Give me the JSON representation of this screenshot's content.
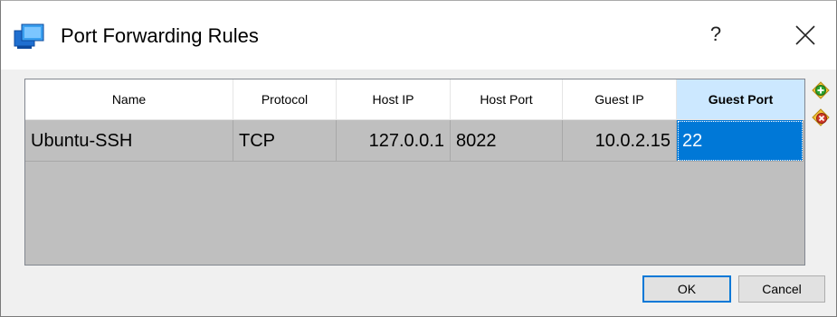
{
  "window": {
    "title": "Port Forwarding Rules",
    "help_label": "?"
  },
  "table": {
    "columns": [
      "Name",
      "Protocol",
      "Host IP",
      "Host Port",
      "Guest IP",
      "Guest Port"
    ],
    "active_column": "Guest Port",
    "rows": [
      {
        "name": "Ubuntu-SSH",
        "protocol": "TCP",
        "host_ip": "127.0.0.1",
        "host_port": "8022",
        "guest_ip": "10.0.2.15",
        "guest_port": "22"
      }
    ]
  },
  "side_actions": {
    "add_icon": "add-rule-icon",
    "remove_icon": "remove-rule-icon"
  },
  "buttons": {
    "ok": "OK",
    "cancel": "Cancel"
  },
  "colors": {
    "selection": "#0078d7",
    "active_header": "#cce8ff",
    "grid_background": "#bfbfbf"
  }
}
